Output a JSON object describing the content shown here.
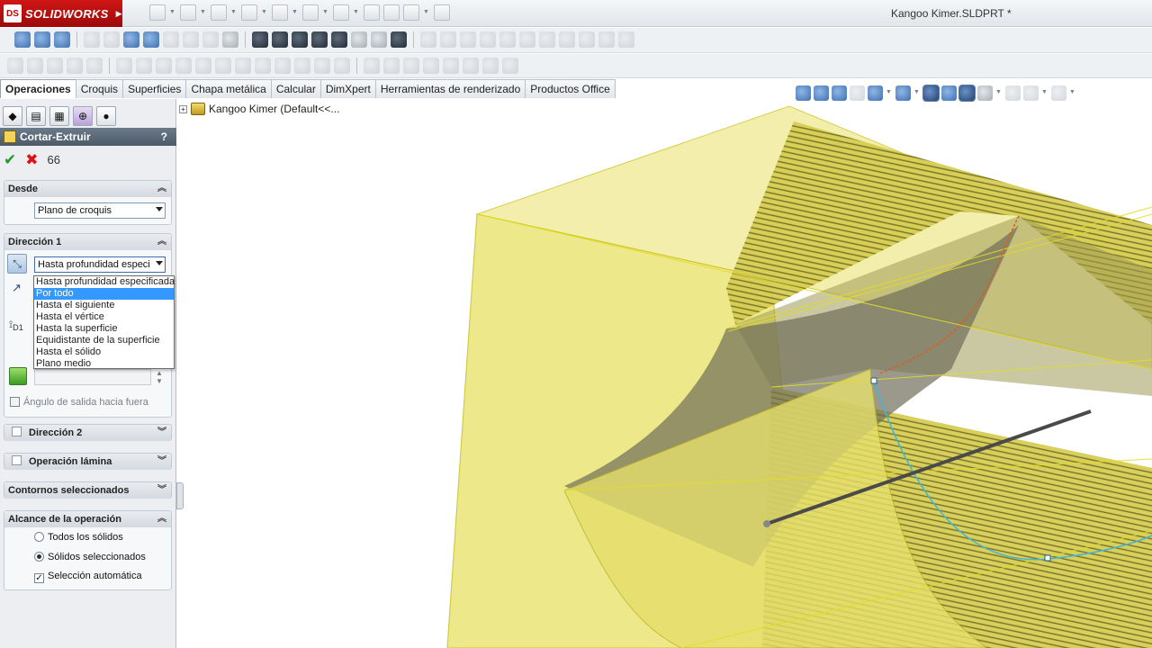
{
  "app": {
    "logo_text": "SOLIDWORKS",
    "logo_badge": "DS",
    "doc_title": "Kangoo Kimer.SLDPRT *"
  },
  "tabs": [
    {
      "label": "Operaciones",
      "active": true
    },
    {
      "label": "Croquis"
    },
    {
      "label": "Superficies"
    },
    {
      "label": "Chapa metálica"
    },
    {
      "label": "Calcular"
    },
    {
      "label": "DimXpert"
    },
    {
      "label": "Herramientas de renderizado"
    },
    {
      "label": "Productos Office"
    }
  ],
  "feature_tree": {
    "root_label": "Kangoo Kimer  (Default<<..."
  },
  "property_manager": {
    "title": "Cortar-Extruir",
    "help": "?",
    "desde": {
      "heading": "Desde",
      "value": "Plano de croquis"
    },
    "direccion1": {
      "heading": "Dirección 1",
      "value": "Hasta profundidad especi",
      "options": [
        "Hasta profundidad especificada",
        "Por todo",
        "Hasta el siguiente",
        "Hasta el vértice",
        "Hasta la superficie",
        "Equidistante de la superficie",
        "Hasta el sólido",
        "Plano medio"
      ],
      "highlighted_option": "Por todo",
      "draft_label": "Ángulo de salida hacia fuera",
      "d1_label": "D1"
    },
    "direccion2": {
      "heading": "Dirección 2"
    },
    "operacion_lamina": {
      "heading": "Operación lámina"
    },
    "contornos": {
      "heading": "Contornos seleccionados"
    },
    "alcance": {
      "heading": "Alcance de la operación",
      "radio_all": "Todos los sólidos",
      "radio_selected": "Sólidos seleccionados",
      "auto_select": "Selección automática"
    }
  },
  "colors": {
    "model_fill": "#e9e27a",
    "edge": "#c8c51a",
    "selection_blue": "#3399ff"
  }
}
